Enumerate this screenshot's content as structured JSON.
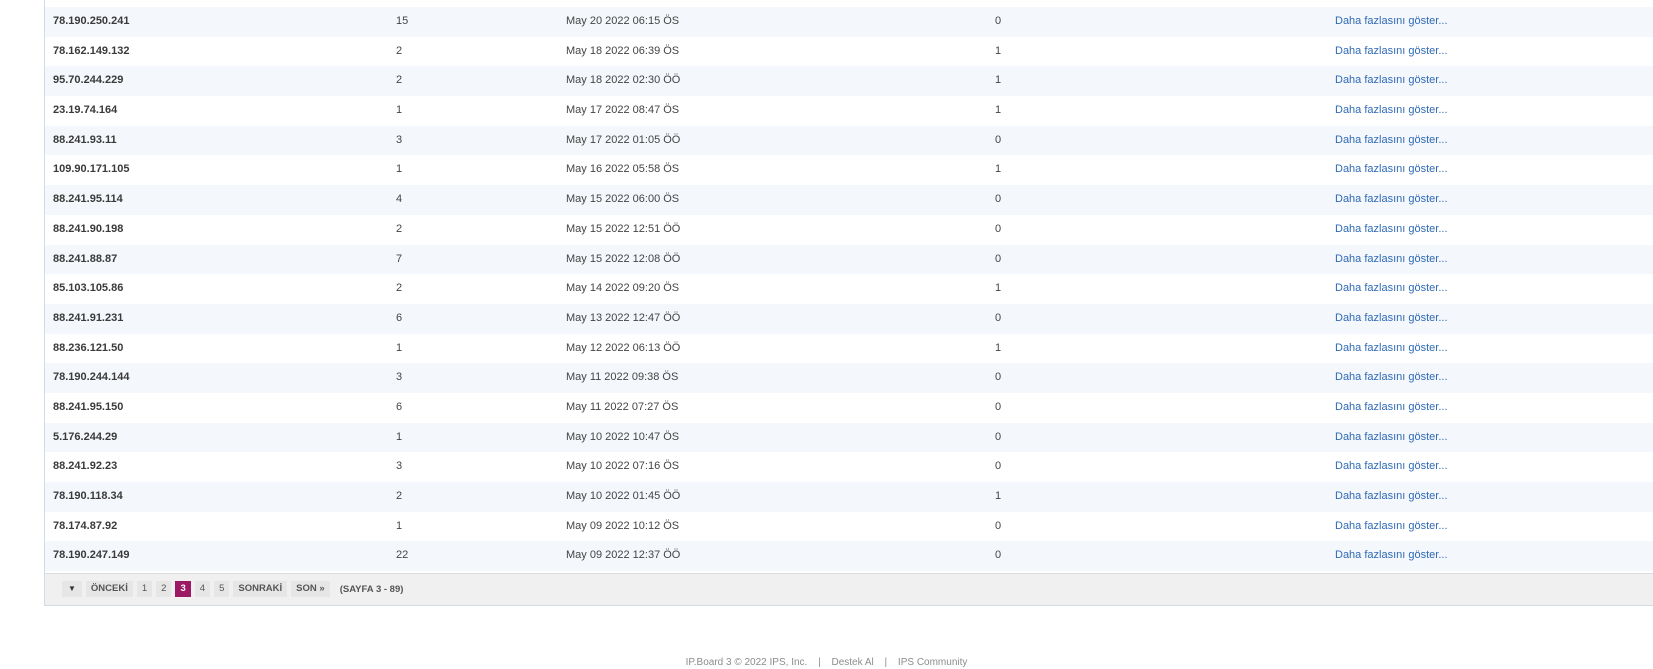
{
  "rows": [
    {
      "ip": "78.190.250.241",
      "count": "15",
      "date": "May 20 2022 06:15 ÖS",
      "num": "0",
      "link": "Daha fazlasını göster..."
    },
    {
      "ip": "78.162.149.132",
      "count": "2",
      "date": "May 18 2022 06:39 ÖS",
      "num": "1",
      "link": "Daha fazlasını göster..."
    },
    {
      "ip": "95.70.244.229",
      "count": "2",
      "date": "May 18 2022 02:30 ÖÖ",
      "num": "1",
      "link": "Daha fazlasını göster..."
    },
    {
      "ip": "23.19.74.164",
      "count": "1",
      "date": "May 17 2022 08:47 ÖS",
      "num": "1",
      "link": "Daha fazlasını göster..."
    },
    {
      "ip": "88.241.93.11",
      "count": "3",
      "date": "May 17 2022 01:05 ÖÖ",
      "num": "0",
      "link": "Daha fazlasını göster..."
    },
    {
      "ip": "109.90.171.105",
      "count": "1",
      "date": "May 16 2022 05:58 ÖS",
      "num": "1",
      "link": "Daha fazlasını göster..."
    },
    {
      "ip": "88.241.95.114",
      "count": "4",
      "date": "May 15 2022 06:00 ÖS",
      "num": "0",
      "link": "Daha fazlasını göster..."
    },
    {
      "ip": "88.241.90.198",
      "count": "2",
      "date": "May 15 2022 12:51 ÖÖ",
      "num": "0",
      "link": "Daha fazlasını göster..."
    },
    {
      "ip": "88.241.88.87",
      "count": "7",
      "date": "May 15 2022 12:08 ÖÖ",
      "num": "0",
      "link": "Daha fazlasını göster..."
    },
    {
      "ip": "85.103.105.86",
      "count": "2",
      "date": "May 14 2022 09:20 ÖS",
      "num": "1",
      "link": "Daha fazlasını göster..."
    },
    {
      "ip": "88.241.91.231",
      "count": "6",
      "date": "May 13 2022 12:47 ÖÖ",
      "num": "0",
      "link": "Daha fazlasını göster..."
    },
    {
      "ip": "88.236.121.50",
      "count": "1",
      "date": "May 12 2022 06:13 ÖÖ",
      "num": "1",
      "link": "Daha fazlasını göster..."
    },
    {
      "ip": "78.190.244.144",
      "count": "3",
      "date": "May 11 2022 09:38 ÖS",
      "num": "0",
      "link": "Daha fazlasını göster..."
    },
    {
      "ip": "88.241.95.150",
      "count": "6",
      "date": "May 11 2022 07:27 ÖS",
      "num": "0",
      "link": "Daha fazlasını göster..."
    },
    {
      "ip": "5.176.244.29",
      "count": "1",
      "date": "May 10 2022 10:47 ÖS",
      "num": "0",
      "link": "Daha fazlasını göster..."
    },
    {
      "ip": "88.241.92.23",
      "count": "3",
      "date": "May 10 2022 07:16 ÖS",
      "num": "0",
      "link": "Daha fazlasını göster..."
    },
    {
      "ip": "78.190.118.34",
      "count": "2",
      "date": "May 10 2022 01:45 ÖÖ",
      "num": "1",
      "link": "Daha fazlasını göster..."
    },
    {
      "ip": "78.174.87.92",
      "count": "1",
      "date": "May 09 2022 10:12 ÖS",
      "num": "0",
      "link": "Daha fazlasını göster..."
    },
    {
      "ip": "78.190.247.149",
      "count": "22",
      "date": "May 09 2022 12:37 ÖÖ",
      "num": "0",
      "link": "Daha fazlasını göster..."
    }
  ],
  "pagination": {
    "dropdown_icon": "caret-down-icon",
    "prev_label": "ÖNCEKİ",
    "pages": [
      "1",
      "2",
      "3",
      "4",
      "5"
    ],
    "active_page": "3",
    "next_label": "SONRAKİ",
    "last_label": "SON »",
    "info": "(SAYFA 3 - 89)"
  },
  "footer": {
    "copyright": "IP.Board 3 © 2022 IPS, Inc.",
    "sep": "|",
    "link1": "Destek Al",
    "link2": "IPS Community"
  },
  "colors": {
    "link": "#2f6ab5",
    "active_page": "#9c1a63",
    "row_alt": "#f4f7fb"
  }
}
